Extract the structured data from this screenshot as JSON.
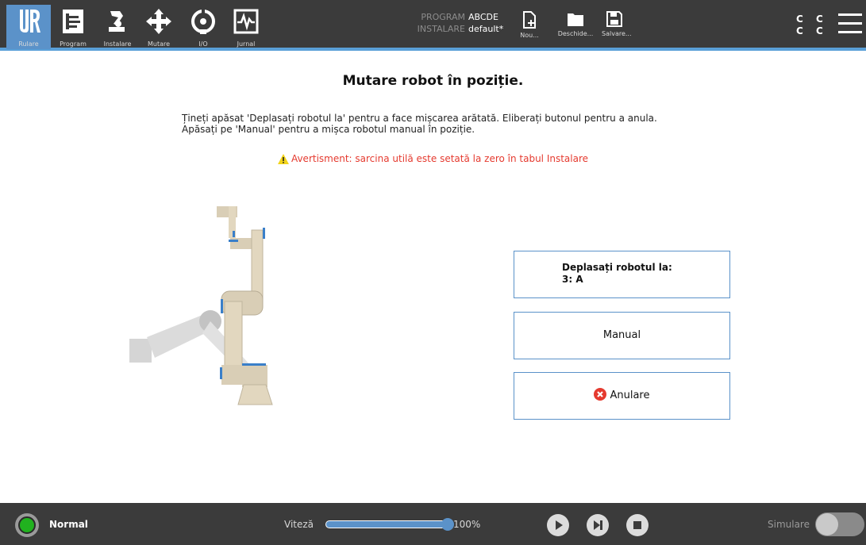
{
  "nav": {
    "items": [
      {
        "label": "Rulare",
        "icon": "ur-logo-icon",
        "active": true
      },
      {
        "label": "Program",
        "icon": "program-icon"
      },
      {
        "label": "Instalare",
        "icon": "installation-icon"
      },
      {
        "label": "Mutare",
        "icon": "move-arrows-icon"
      },
      {
        "label": "I/O",
        "icon": "io-icon"
      },
      {
        "label": "Jurnal",
        "icon": "log-icon"
      }
    ]
  },
  "program_info": {
    "program_key": "PROGRAM",
    "program_value": "ABCDE",
    "installation_key": "INSTALARE",
    "installation_value": "default*"
  },
  "file_actions": {
    "new_label": "Nou...",
    "open_label": "Deschide...",
    "save_label": "Salvare..."
  },
  "status_indicator": {
    "line1": "C C",
    "line2": "C C"
  },
  "main": {
    "title": "Mutare robot în poziție.",
    "instruction_line1": "Țineți apăsat 'Deplasați robotul la' pentru a face mișcarea arătată. Eliberați butonul pentru a anula.",
    "instruction_line2": "Apăsați pe 'Manual' pentru a mișca robotul manual în poziție.",
    "warning": "Avertisment: sarcina utilă este setată la zero în tabul Instalare",
    "move_button_line1": "Deplasați robotul la:",
    "move_button_line2": "3: A",
    "manual_button": "Manual",
    "cancel_button": "Anulare"
  },
  "footer": {
    "robot_state": "Normal",
    "speed_label": "Viteză",
    "speed_value": "100%",
    "speed_fraction": 1.0,
    "simulation_label": "Simulare",
    "simulation_on": false
  },
  "colors": {
    "accent": "#5b92c9",
    "topbar": "#3b3b3b",
    "warning": "#e53a2f",
    "status_ok": "#21b21f",
    "cancel_icon": "#e53a2f"
  }
}
